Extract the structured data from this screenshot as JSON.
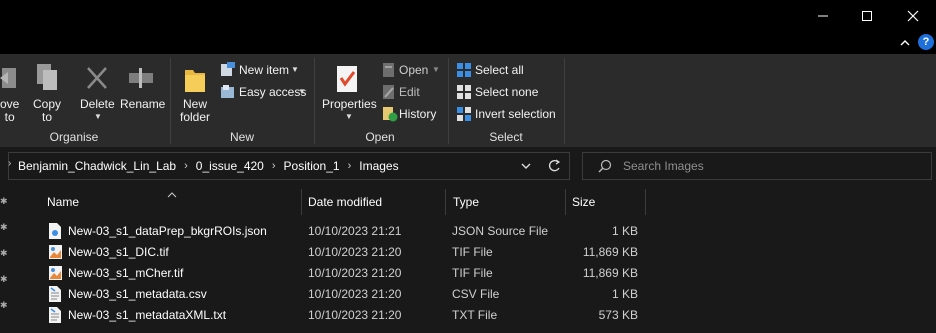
{
  "window": {
    "controls": {
      "minimize": "—",
      "maximize": "☐",
      "close": "✕"
    }
  },
  "ribbon_strip": {
    "chevron": "^",
    "help": "?"
  },
  "ribbon": {
    "organise": {
      "label": "Organise",
      "move_to": {
        "line1": "ove",
        "line2": "to"
      },
      "copy_to": {
        "line1": "Copy",
        "line2": "to"
      },
      "delete": "Delete",
      "rename": "Rename"
    },
    "new": {
      "label": "New",
      "new_folder": {
        "line1": "New",
        "line2": "folder"
      },
      "new_item": "New item",
      "easy_access": "Easy access"
    },
    "open": {
      "label": "Open",
      "properties": "Properties",
      "open": "Open",
      "edit": "Edit",
      "history": "History"
    },
    "select": {
      "label": "Select",
      "select_all": "Select all",
      "select_none": "Select none",
      "invert_selection": "Invert selection"
    }
  },
  "address": {
    "crumbs": [
      "Benjamin_Chadwick_Lin_Lab",
      "0_issue_420",
      "Position_1",
      "Images"
    ],
    "search_placeholder": "Search Images"
  },
  "columns": {
    "name": "Name",
    "date": "Date modified",
    "type": "Type",
    "size": "Size"
  },
  "files": [
    {
      "name": "New-03_s1_dataPrep_bkgrROIs.json",
      "date": "10/10/2023 21:21",
      "type": "JSON Source File",
      "size": "1 KB",
      "icon": "json-file-icon"
    },
    {
      "name": "New-03_s1_DIC.tif",
      "date": "10/10/2023 21:20",
      "type": "TIF File",
      "size": "11,869 KB",
      "icon": "image-file-icon"
    },
    {
      "name": "New-03_s1_mCher.tif",
      "date": "10/10/2023 21:20",
      "type": "TIF File",
      "size": "11,869 KB",
      "icon": "image-file-icon"
    },
    {
      "name": "New-03_s1_metadata.csv",
      "date": "10/10/2023 21:20",
      "type": "CSV File",
      "size": "1 KB",
      "icon": "csv-file-icon"
    },
    {
      "name": "New-03_s1_metadataXML.txt",
      "date": "10/10/2023 21:20",
      "type": "TXT File",
      "size": "573 KB",
      "icon": "text-file-icon"
    }
  ],
  "colors": {
    "background": "#191919",
    "ribbon": "#2b2b2b",
    "accent": "#3a8ee6"
  }
}
